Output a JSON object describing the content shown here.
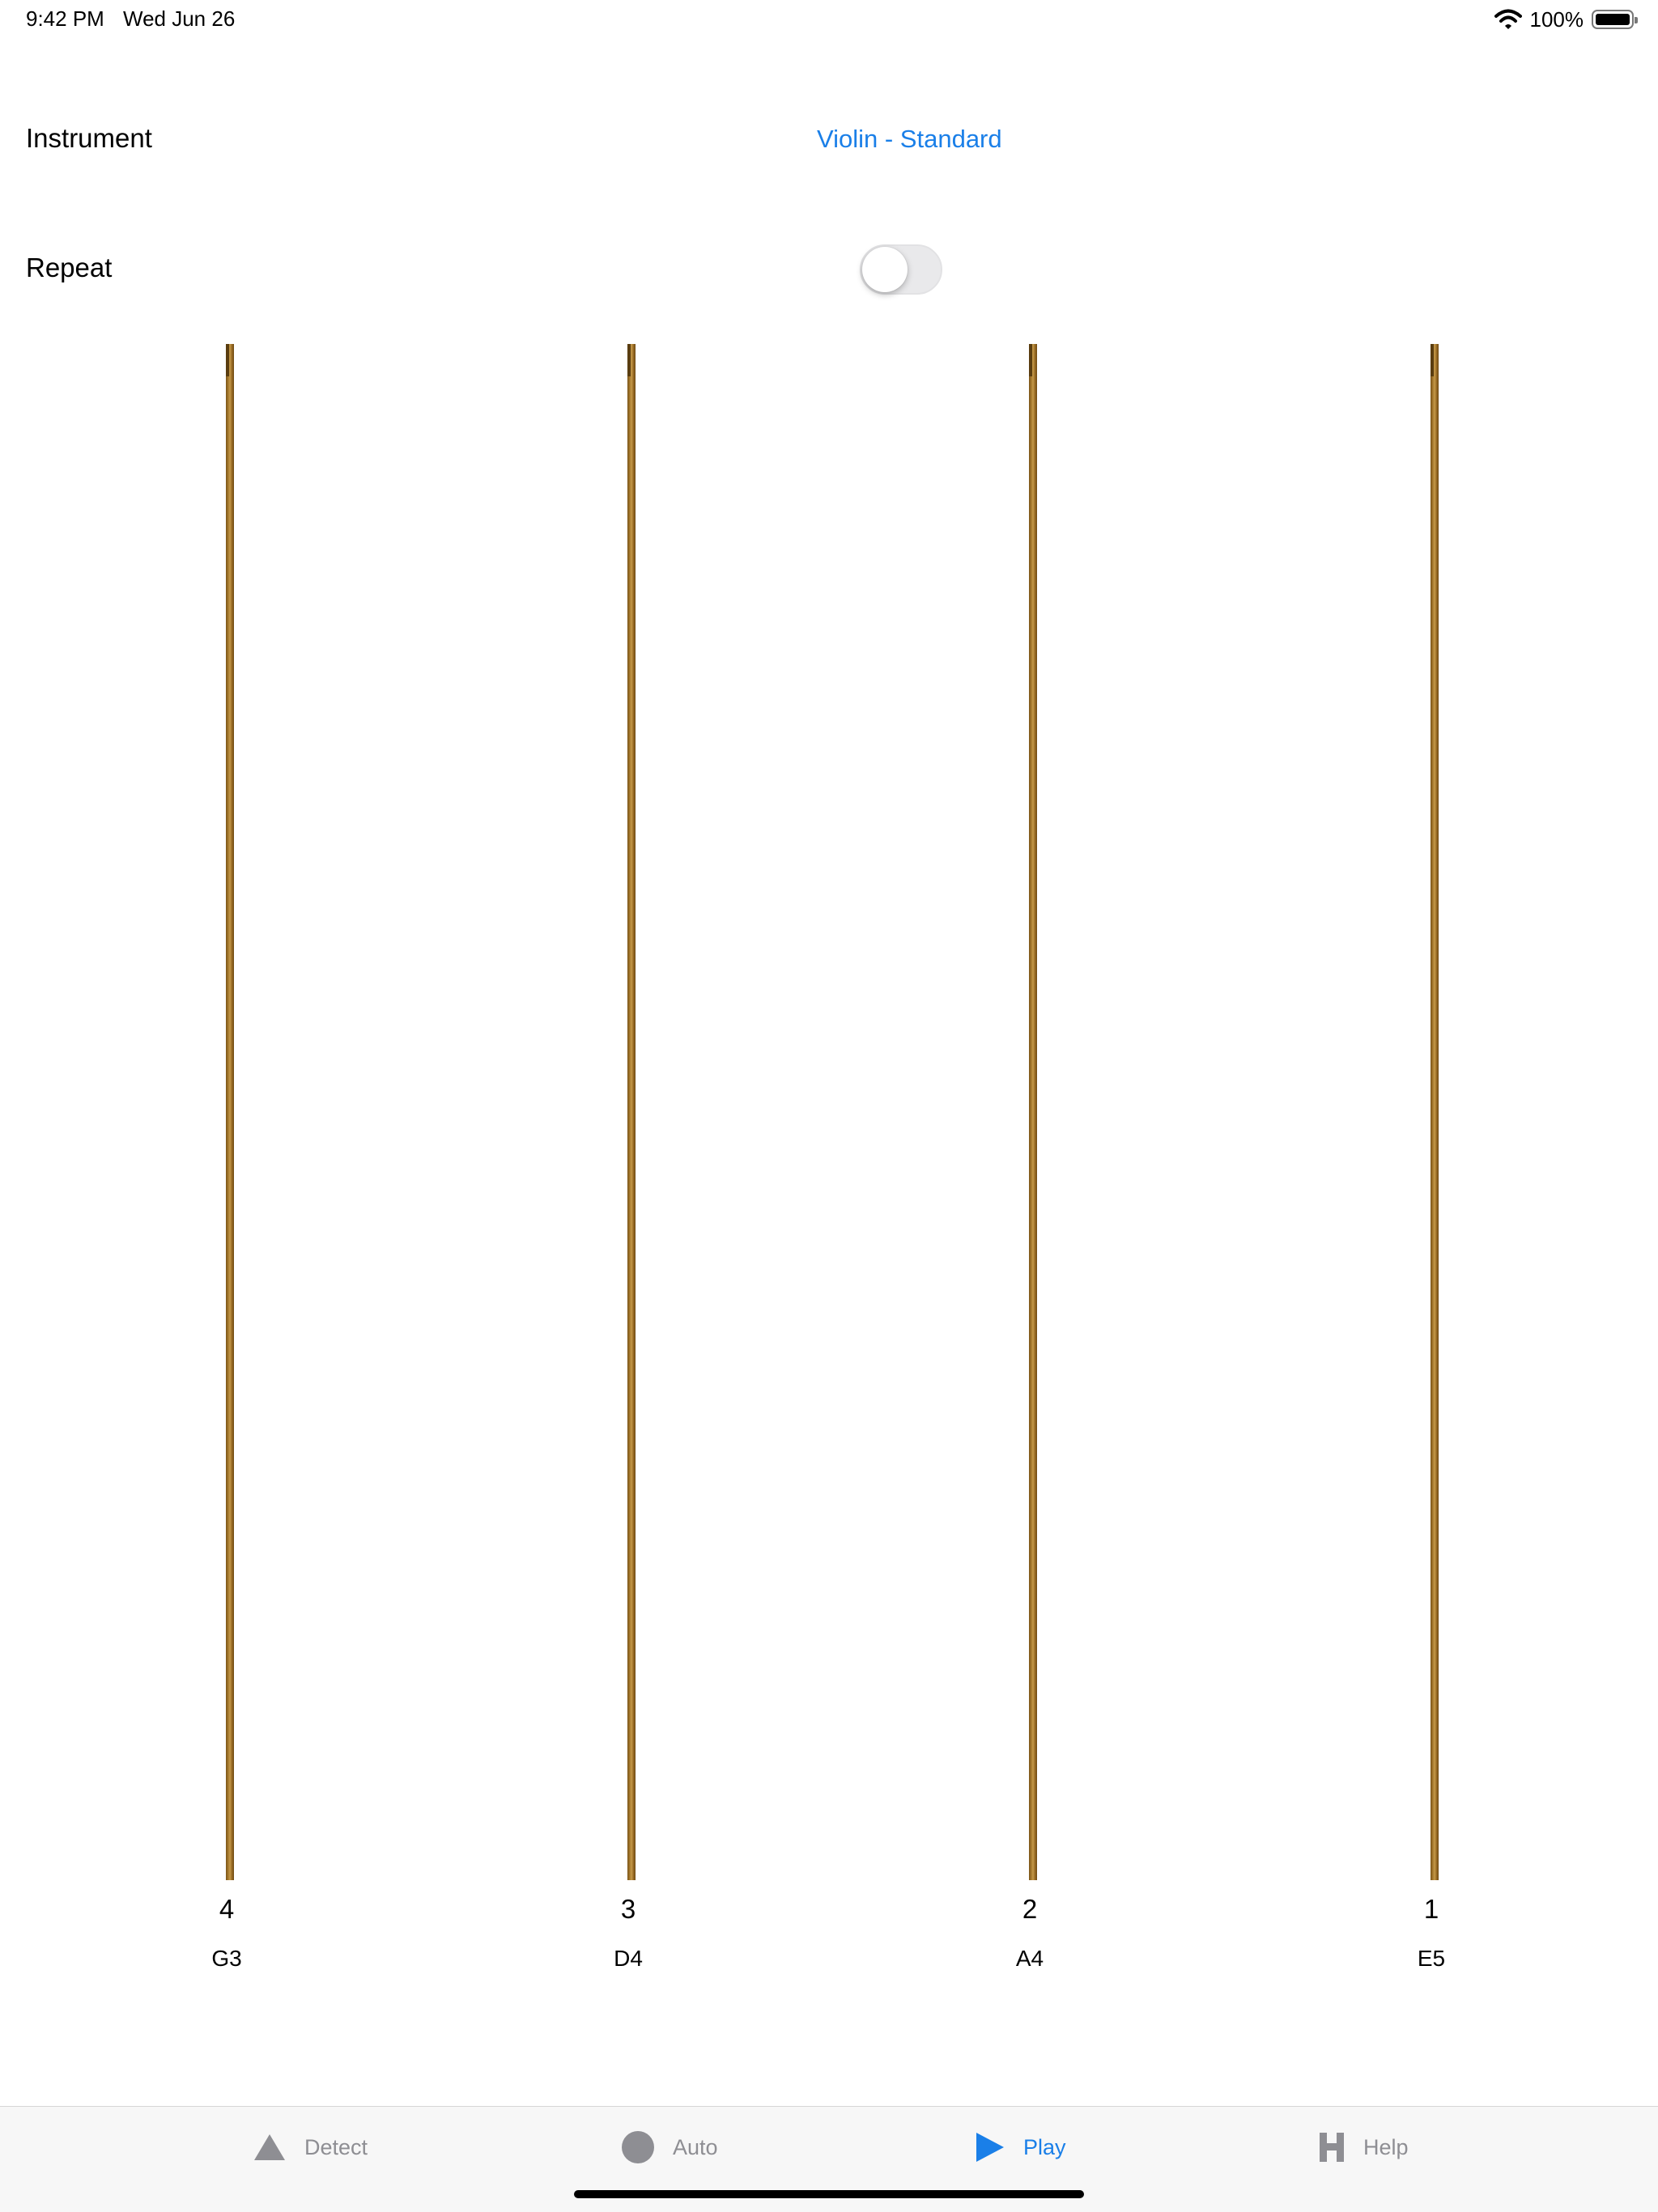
{
  "status_bar": {
    "time": "9:42 PM",
    "date": "Wed Jun 26",
    "battery": "100%"
  },
  "settings": {
    "instrument_label": "Instrument",
    "instrument_value": "Violin - Standard",
    "repeat_label": "Repeat",
    "repeat_enabled": false
  },
  "strings": [
    {
      "number": "4",
      "note": "G3"
    },
    {
      "number": "3",
      "note": "D4"
    },
    {
      "number": "2",
      "note": "A4"
    },
    {
      "number": "1",
      "note": "E5"
    }
  ],
  "tab_bar": {
    "tabs": [
      {
        "label": "Detect",
        "icon": "triangle-icon",
        "active": false
      },
      {
        "label": "Auto",
        "icon": "circle-icon",
        "active": false
      },
      {
        "label": "Play",
        "icon": "play-icon",
        "active": true
      },
      {
        "label": "Help",
        "icon": "h-icon",
        "active": false
      }
    ]
  },
  "colors": {
    "accent": "#1a7fe8",
    "inactive_tab": "#8e8e93",
    "string": "#a77a2e"
  }
}
